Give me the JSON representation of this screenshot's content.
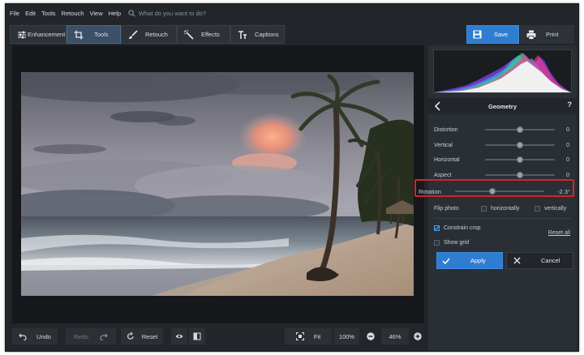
{
  "menu": [
    "File",
    "Edit",
    "Tools",
    "Retouch",
    "View",
    "Help"
  ],
  "search": {
    "placeholder": "What do you want to do?"
  },
  "tabs": [
    {
      "label": "Enhancement",
      "icon": "sliders-icon"
    },
    {
      "label": "Tools",
      "icon": "crop-icon",
      "active": true
    },
    {
      "label": "Retouch",
      "icon": "brush-icon"
    },
    {
      "label": "Effects",
      "icon": "magic-wand-icon"
    },
    {
      "label": "Captions",
      "icon": "text-icon"
    }
  ],
  "actions": {
    "save": "Save",
    "print": "Print"
  },
  "bottom": {
    "undo": "Undo",
    "redo": "Redo",
    "reset": "Reset",
    "fit": "Fit",
    "zoom_100": "100%",
    "zoom_current": "46%"
  },
  "geometry": {
    "title": "Geometry",
    "help": "?",
    "sliders": [
      {
        "label": "Distortion",
        "value": "0",
        "level": 0.5
      },
      {
        "label": "Vertical",
        "value": "0",
        "level": 0.5
      },
      {
        "label": "Horizontal",
        "value": "0",
        "level": 0.5
      },
      {
        "label": "Aspect",
        "value": "0",
        "level": 0.5
      }
    ],
    "rotation": {
      "label": "Rotation",
      "value": "-2.3°",
      "level": 0.42
    },
    "flip": {
      "label": "Flip photo",
      "horizontally": "horizontally",
      "vertically": "vertically"
    },
    "constrain_crop": "Constrain crop",
    "show_grid": "Show grid",
    "reset_all": "Reset all",
    "apply": "Apply",
    "cancel": "Cancel"
  },
  "colors": {
    "accent": "#2f7dd1",
    "highlight": "#d4232b",
    "background": "#22262b"
  }
}
